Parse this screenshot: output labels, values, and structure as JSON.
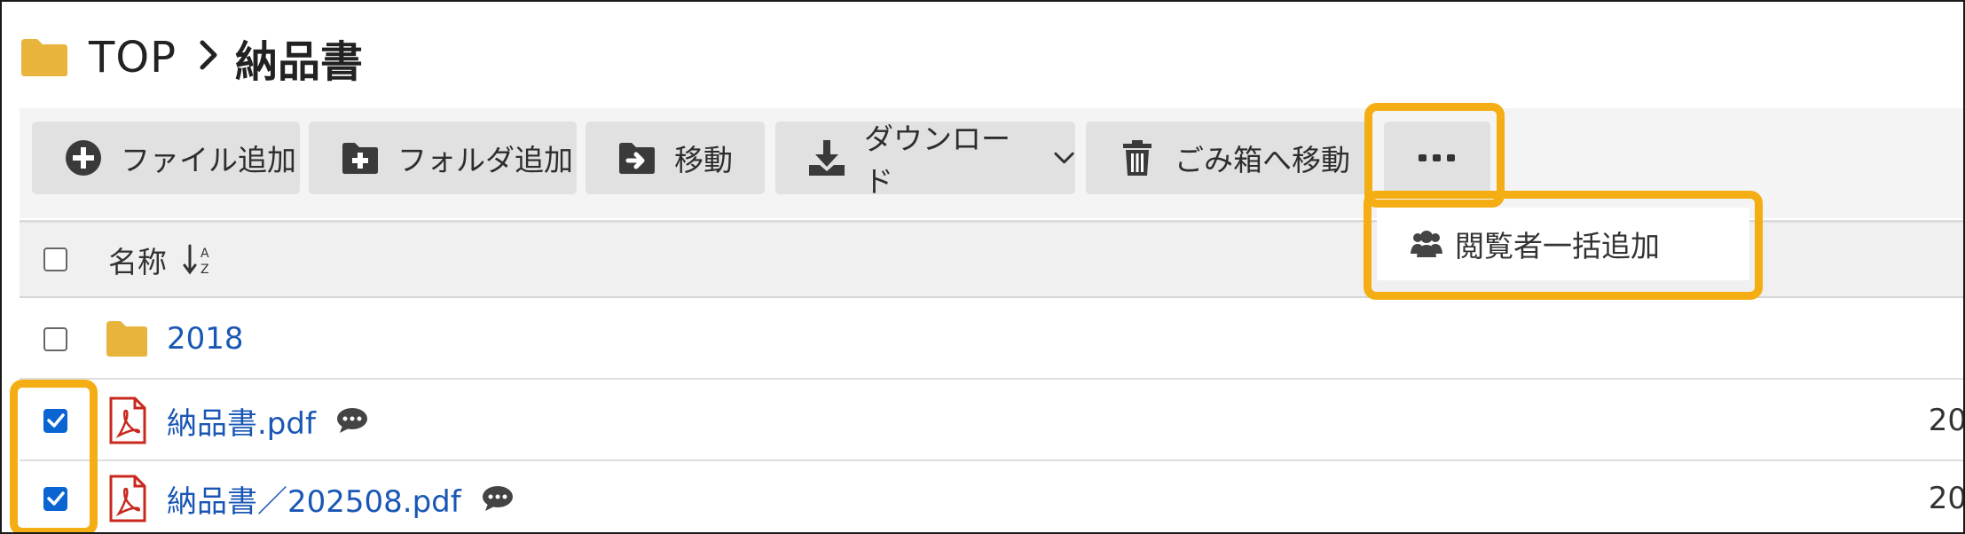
{
  "breadcrumb": {
    "root": "TOP",
    "separator": "›",
    "current": "納品書"
  },
  "toolbar": {
    "add_file": "ファイル追加",
    "add_folder": "フォルダ追加",
    "move": "移動",
    "download": "ダウンロード",
    "trash": "ごみ箱へ移動",
    "more": "..."
  },
  "more_menu": {
    "items": [
      {
        "label": "閲覧者一括追加",
        "icon": "users-icon"
      }
    ]
  },
  "table": {
    "header": {
      "name": "名称",
      "sort_icon": "sort-alpha-icon"
    },
    "rows": [
      {
        "type": "folder",
        "name": "2018",
        "checked": false,
        "date": ""
      },
      {
        "type": "pdf",
        "name": "納品書.pdf",
        "checked": true,
        "date": "20",
        "comment": true
      },
      {
        "type": "pdf",
        "name": "納品書／202508.pdf",
        "checked": true,
        "date": "20",
        "comment": true
      }
    ]
  },
  "colors": {
    "highlight": "#f5ad14",
    "folder": "#e8b43c",
    "link": "#1a57b5",
    "checkbox": "#0a64d2",
    "pdf": "#c8281e"
  }
}
